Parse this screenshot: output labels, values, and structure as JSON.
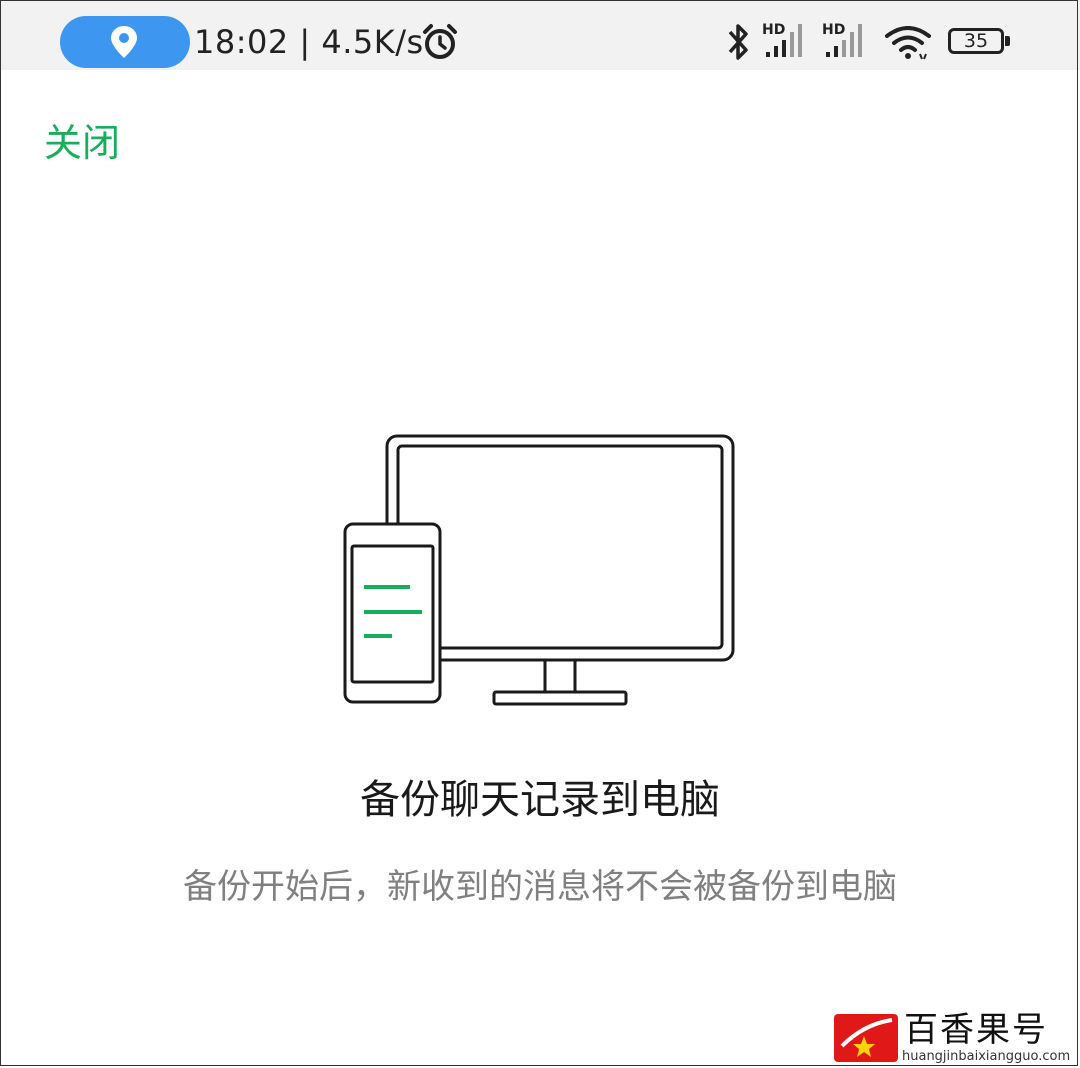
{
  "status_bar": {
    "time": "18:02",
    "network_speed": "4.5K/s",
    "battery_level": "35",
    "icons": [
      "location-icon",
      "alarm-icon",
      "bluetooth-icon",
      "signal-hd-icon",
      "signal-hd-icon",
      "wifi-icon",
      "battery-icon"
    ]
  },
  "header": {
    "close_label": "关闭"
  },
  "main": {
    "title": "备份聊天记录到电脑",
    "subtitle": "备份开始后，新收到的消息将不会被备份到电脑"
  },
  "watermark": {
    "name": "百香果号",
    "url": "huangjinbaixiangguo.com"
  },
  "colors": {
    "accent": "#1aad5c",
    "location_pill": "#3d97f0",
    "subtitle": "#808080"
  }
}
